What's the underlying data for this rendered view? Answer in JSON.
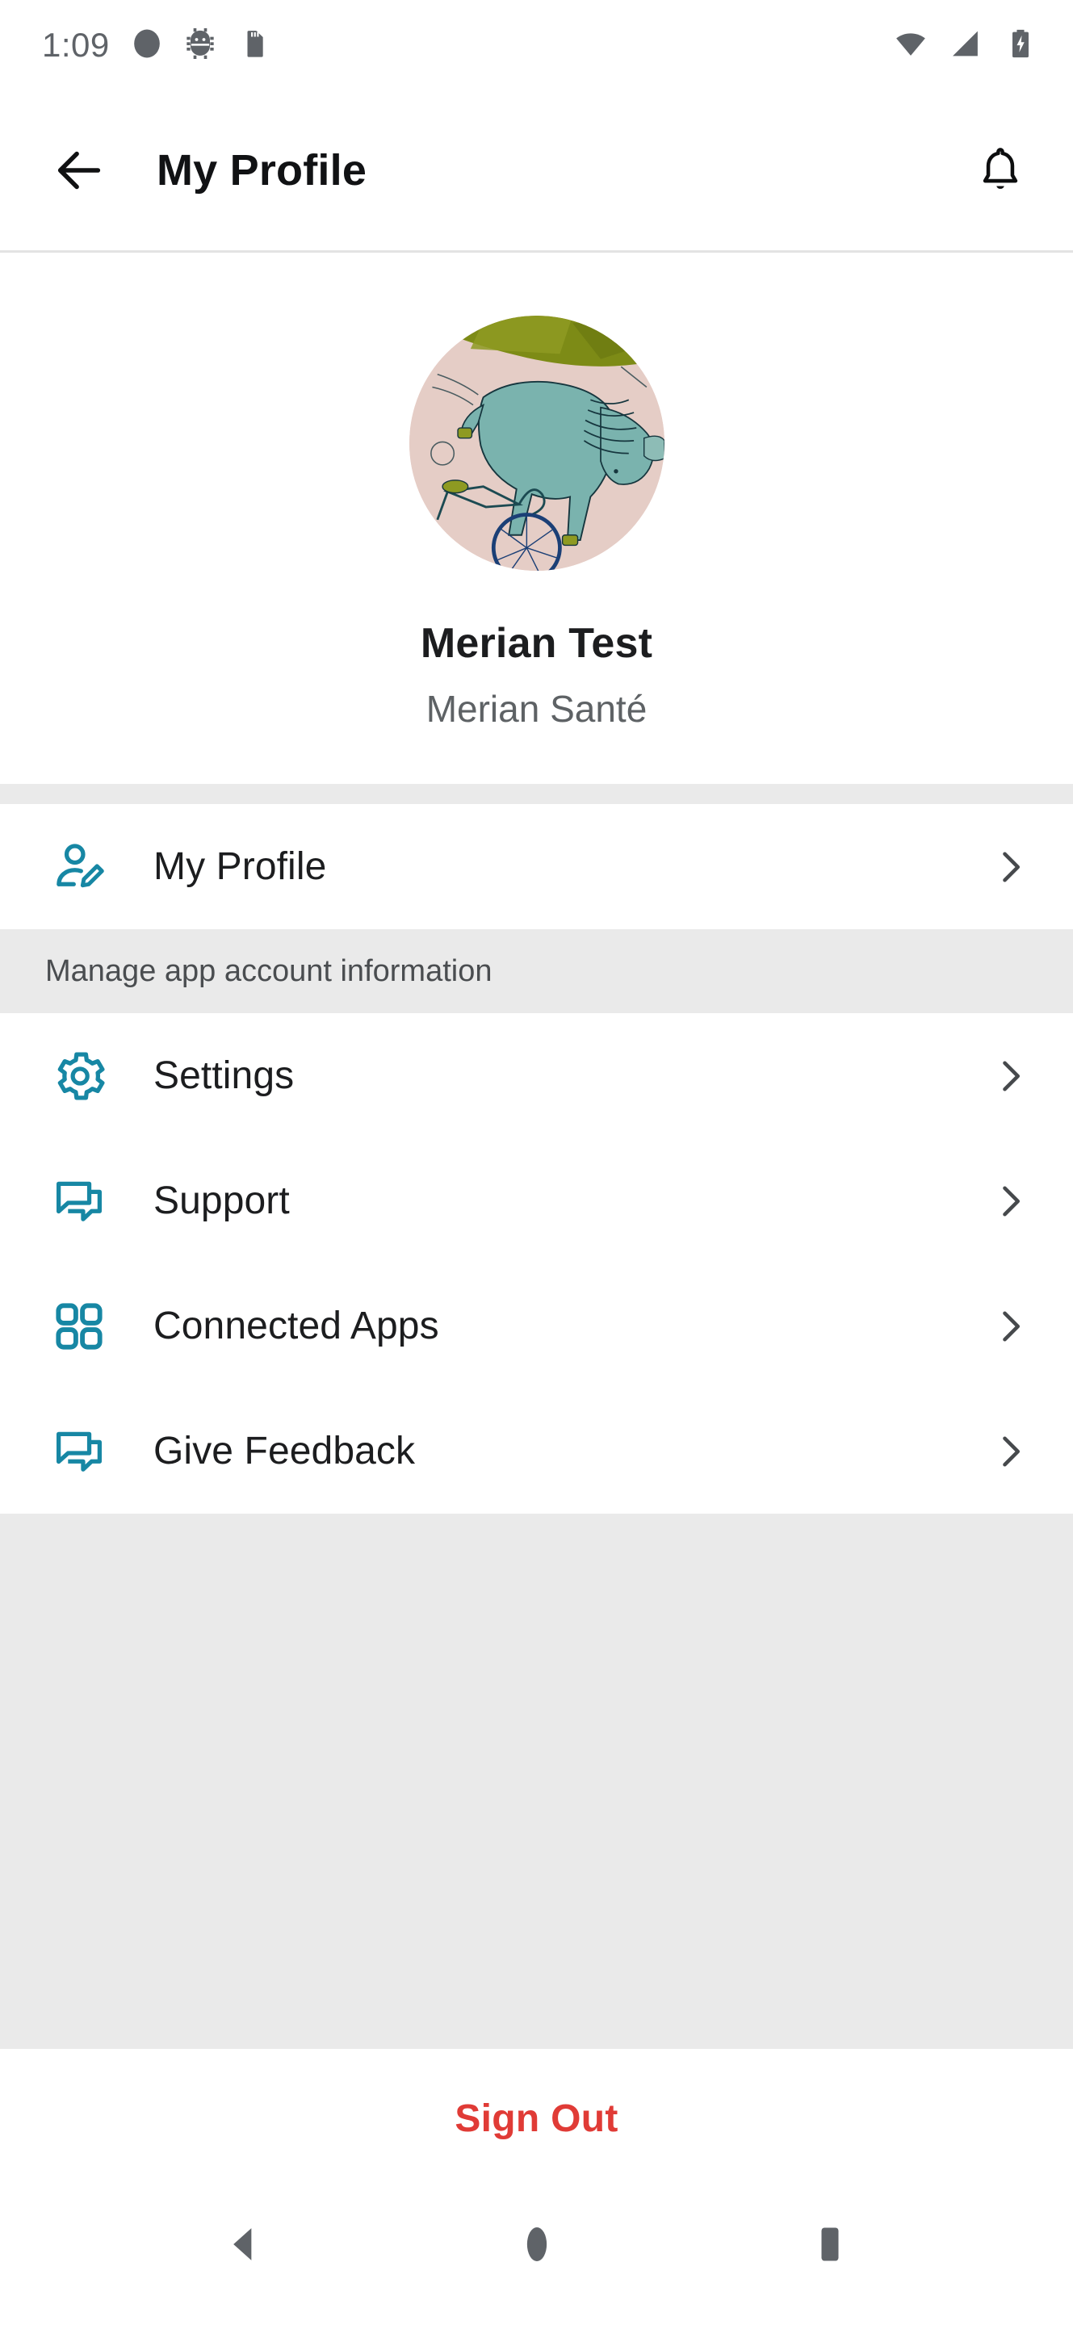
{
  "status_bar": {
    "clock": "1:09",
    "left_icons": [
      "circle-dot-icon",
      "android-bug-icon",
      "sd-card-icon"
    ],
    "right_icons": [
      "wifi-icon",
      "cellular-signal-icon",
      "battery-charging-icon"
    ],
    "icon_color": "#5f6368"
  },
  "app_bar": {
    "back_label": "back-arrow",
    "title": "My Profile",
    "notification_label": "notifications-bell"
  },
  "profile": {
    "avatar_alt": "user-avatar-illustration-horse-bicycle",
    "name": "Merian Test",
    "organization": "Merian Santé"
  },
  "menu": {
    "primary": [
      {
        "id": "my-profile",
        "label": "My Profile",
        "icon": "person-edit-icon"
      }
    ],
    "section_header": "Manage app account information",
    "items": [
      {
        "id": "settings",
        "label": "Settings",
        "icon": "gear-icon"
      },
      {
        "id": "support",
        "label": "Support",
        "icon": "chat-bubbles-icon"
      },
      {
        "id": "connected-apps",
        "label": "Connected Apps",
        "icon": "grid-apps-icon"
      },
      {
        "id": "give-feedback",
        "label": "Give Feedback",
        "icon": "chat-bubbles-icon"
      }
    ],
    "chevron_icon": "chevron-right-icon"
  },
  "sign_out": {
    "label": "Sign Out",
    "color": "#e03b36"
  },
  "nav_bar": {
    "back": "nav-back-triangle",
    "home": "nav-home-circle",
    "recents": "nav-recents-square"
  },
  "colors": {
    "accent_teal": "#1787a4",
    "band_gray": "#eaeaea",
    "text_primary": "#1c1d1f",
    "text_secondary": "#5e6265",
    "chevron": "#46494c"
  }
}
